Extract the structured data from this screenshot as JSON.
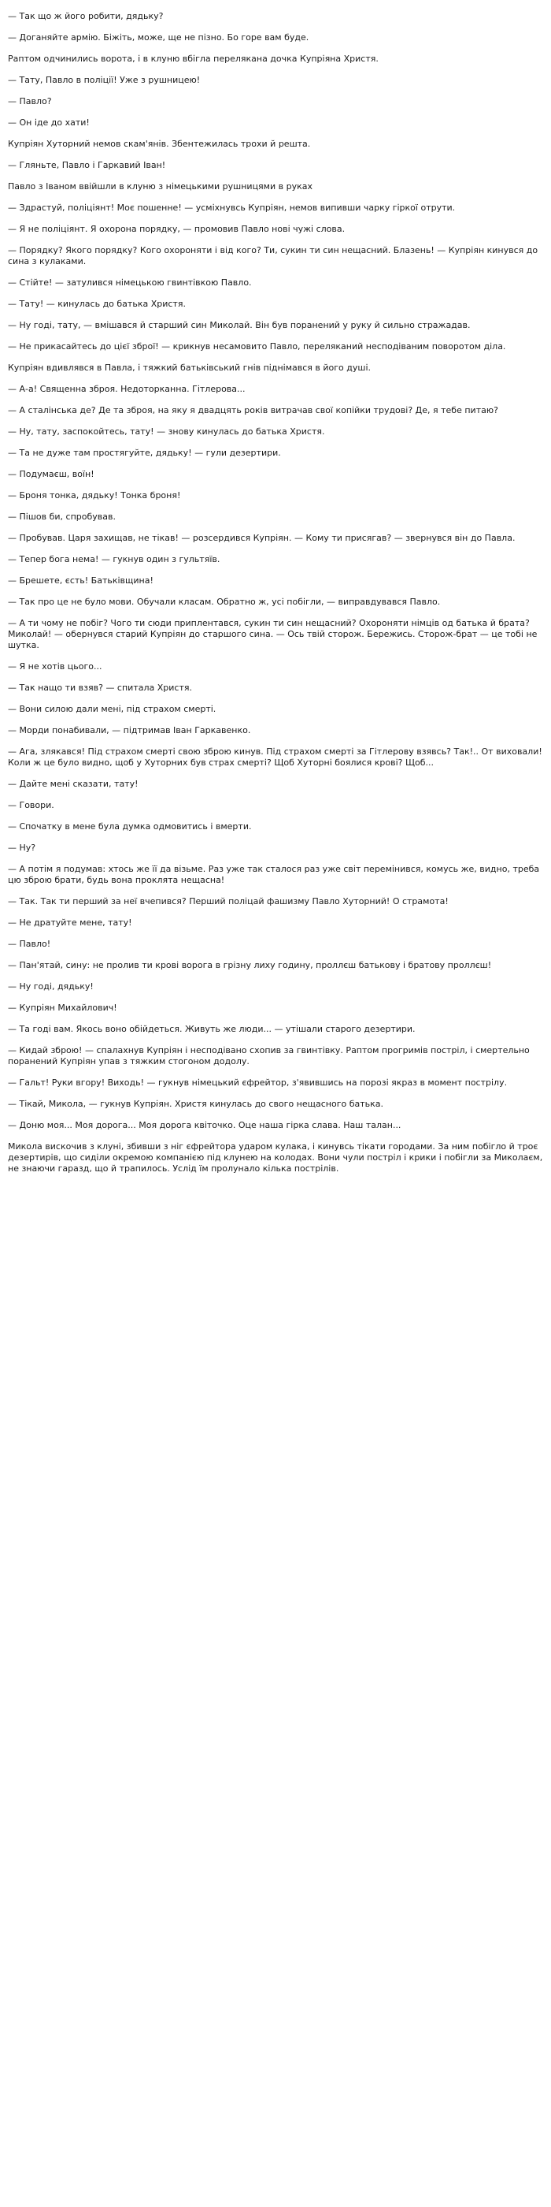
{
  "paragraphs": [
    "— Так що ж його робити, дядьку?",
    "— Доганяйте армію. Біжіть, може, ще не пізно. Бо горе вам буде.",
    "Раптом одчинились ворота, і в клуню вбігла перелякана дочка Купріяна Христя.",
    "— Тату, Павло в поліції! Уже з рушницею!",
    "— Павло?",
    "— Он іде до хати!",
    "Купріян Хуторний немов скам'янів. Збентежилась трохи й решта.",
    "— Гляньте, Павло і Гаркавий Іван!",
    "Павло з Іваном ввійшли в клуню з німецькими рушницями в руках",
    "— Здрастуй, поліціянт! Моє пошенне! — усміхнувсь Купріян, немов випивши чарку гіркої отрути.",
    "— Я не поліціянт. Я охорона порядку, — промовив Павло нові чужі слова.",
    "— Порядку? Якого порядку? Кого охороняти і від кого? Ти, сукин ти син нещасний. Блазень! — Купріян кинувся до сина з кулаками.",
    "— Стійте! — затулився німецькою гвинтівкою Павло.",
    "— Тату! — кинулась до батька Христя.",
    "— Ну годі, тату, — вмішався й старший син Миколай. Він був поранений у руку й сильно стражадав.",
    "— Не прикасайтесь до цієї зброї! — крикнув несамовито Павло, переляканий несподіваним поворотом діла.",
    "Купріян вдивлявся в Павла, і тяжкий батьківський гнів піднімався в його душі.",
    "— А-а! Священна зброя. Недоторканна. Гітлерова...",
    "— А сталінська де? Де та зброя, на яку я двадцять років витрачав свої копійки трудові? Де, я тебе питаю?",
    "— Ну, тату, заспокойтесь, тату! — знову кинулась до батька Христя.",
    "— Та не дуже там простягуйте, дядьку! — гули дезертири.",
    "— Подумаєш, воїн!",
    "— Броня тонка, дядьку! Тонка броня!",
    "— Пішов би, спробував.",
    "— Пробував. Царя захищав, не тікав! — розсердився Купріян. — Кому ти присягав? — звернувся він до Павла.",
    "— Тепер бога нема! — гукнув один з гультяїв.",
    "— Брешете, єсть! Батьківщина!",
    "— Так про це не було мови. Обучали класам. Обратно ж, усі побігли, — виправдувався Павло.",
    "— А ти чому не побіг? Чого ти сюди приплентався, сукин ти син нещасний? Охороняти німців од батька й брата? Миколай! — обернувся старий Купріян до старшого сина. — Ось твій сторож. Бережись. Сторож-брат — це тобі не шутка.",
    "— Я не хотів цього...",
    "— Так нащо ти взяв? — спитала Христя.",
    "— Вони силою дали мені, під страхом смерті.",
    "— Морди понабивали, — підтримав Іван Гаркавенко.",
    "— Ага, злякався! Під страхом смерті свою зброю кинув. Під страхом смерті за Гітлерову взявсь? Так!.. От виховали! Коли ж це було видно, щоб у Хуторних був страх смерті? Щоб Хуторні боялися крові? Щоб...",
    "— Дайте мені сказати, тату!",
    "— Говори.",
    "— Спочатку в мене була думка одмовитись і вмерти.",
    "— Ну?",
    "— А потім я подумав: хтось же її да візьме. Раз уже так сталося раз уже світ перемінився, комусь же, видно, треба цю зброю брати, будь вона проклята нещасна!",
    "— Так. Так ти перший за неї вчепився? Перший поліцай фашизму Павло Хуторний! О страмота!",
    "— Не дратуйте мене, тату!",
    "— Павло!",
    "— Пан'ятай, сину: не пролив ти крові ворога в грізну лиху годину, проллєш батькову і братову проллєш!",
    "— Ну годі, дядьку!",
    "— Купріян Михайлович!",
    "— Та годі вам. Якось воно обійдеться. Живуть же люди... — утішали старого дезертири.",
    "— Кидай зброю! — спалахнув Купріян і несподівано схопив за гвинтівку. Раптом прогримів постріл, і смертельно поранений Купріян упав з тяжким стогоном додолу.",
    "— Гальт! Руки вгору! Виходь! — гукнув німецький єфрейтор, з'явившись на порозі якраз в момент пострілу.",
    "— Тікай, Микола, — гукнув Купріян. Христя кинулась до свого нещасного батька.",
    "— Доню моя... Моя дорога... Моя дорога квіточко. Оце наша гірка слава. Наш талан...",
    "Микола вискочив з клуні, збивши з ніг єфрейтора ударом кулака, і кинувсь тікати городами. За ним побігло й троє дезертирів, що сиділи окремою компанією під клунею на колодах. Вони чули постріл і крики і побігли за Миколаєм, не знаючи гаразд, що й трапилось. Услід їм пролунало кілька пострілів."
  ]
}
